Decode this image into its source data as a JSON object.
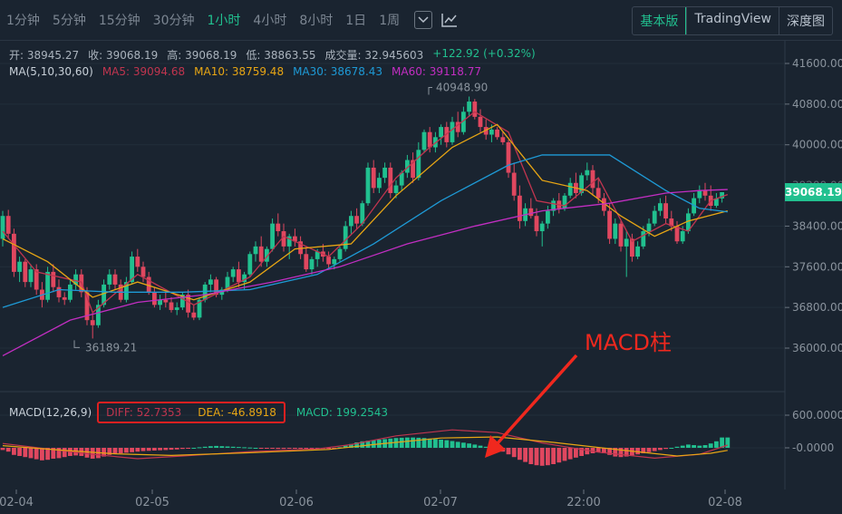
{
  "toolbar": {
    "intervals": [
      "1分钟",
      "5分钟",
      "15分钟",
      "30分钟",
      "1小时",
      "4小时",
      "8小时",
      "1日",
      "1周"
    ],
    "active_interval": "1小时",
    "views": [
      "基本版",
      "TradingView",
      "深度图"
    ],
    "active_view": "基本版"
  },
  "ohlc": {
    "open": "开: 38945.27",
    "close": "收: 39068.19",
    "high": "高: 39068.19",
    "low": "低: 38863.55",
    "volume": "成交量: 32.945603",
    "change": "+122.92 (+0.32%)"
  },
  "ma": {
    "label": "MA(5,10,30,60)",
    "ma5": "MA5: 39094.68",
    "ma10": "MA10: 38759.48",
    "ma30": "MA30: 38678.43",
    "ma60": "MA60: 39118.77"
  },
  "macd": {
    "label": "MACD(12,26,9)",
    "diff": "DIFF: 52.7353",
    "dea": "DEA: -46.8918",
    "macd": "MACD: 199.2543"
  },
  "current_price": "39068.19",
  "annotation": "MACD柱",
  "colors": {
    "up": "#21c08f",
    "down": "#e0475f",
    "ma5": "#c0354f",
    "ma10": "#e8a614",
    "ma30": "#1e9ad6",
    "ma60": "#c22ec2",
    "arrow": "#f0281e"
  },
  "chart_data": {
    "type": "candlestick",
    "price_axis": {
      "ticks": [
        41600,
        40800,
        40000,
        38400,
        37600,
        36800,
        36000
      ],
      "ylim": [
        35700,
        41850
      ]
    },
    "x_ticks": [
      "02-04",
      "02-05",
      "02-06",
      "02-07",
      "22:00",
      "02-08"
    ],
    "high_marker": "40948.90",
    "low_marker": "36189.21",
    "macd_axis": {
      "ticks": [
        "600.0000",
        "-0.0000"
      ]
    },
    "ohlc": [
      [
        38150,
        38700,
        38000,
        38600
      ],
      [
        38600,
        38720,
        38150,
        38250
      ],
      [
        38250,
        38350,
        37400,
        37500
      ],
      [
        37500,
        37800,
        37300,
        37700
      ],
      [
        37700,
        37750,
        37200,
        37300
      ],
      [
        37300,
        37650,
        37200,
        37550
      ],
      [
        37550,
        37650,
        37050,
        37150
      ],
      [
        37150,
        37300,
        36800,
        36950
      ],
      [
        36950,
        37600,
        36900,
        37500
      ],
      [
        37500,
        37650,
        37100,
        37200
      ],
      [
        37200,
        37350,
        36900,
        37000
      ],
      [
        37000,
        37100,
        36850,
        36950
      ],
      [
        36950,
        37350,
        36900,
        37250
      ],
      [
        37250,
        37550,
        37150,
        37450
      ],
      [
        37450,
        37550,
        37000,
        37100
      ],
      [
        37100,
        37200,
        36450,
        36550
      ],
      [
        36550,
        36700,
        36189,
        36450
      ],
      [
        36450,
        36950,
        36400,
        36850
      ],
      [
        36850,
        37350,
        36800,
        37250
      ],
      [
        37250,
        37550,
        37150,
        37450
      ],
      [
        37450,
        37550,
        37150,
        37250
      ],
      [
        37250,
        37350,
        36900,
        36950
      ],
      [
        36950,
        37400,
        36900,
        37300
      ],
      [
        37300,
        37900,
        37250,
        37800
      ],
      [
        37800,
        37950,
        37500,
        37600
      ],
      [
        37600,
        37700,
        37300,
        37400
      ],
      [
        37400,
        37500,
        37050,
        37100
      ],
      [
        37100,
        37200,
        36800,
        36850
      ],
      [
        36850,
        37050,
        36750,
        36950
      ],
      [
        36950,
        37100,
        36800,
        36900
      ],
      [
        36900,
        37000,
        36700,
        36750
      ],
      [
        36750,
        36900,
        36650,
        36800
      ],
      [
        36800,
        37100,
        36750,
        37050
      ],
      [
        37050,
        37150,
        36600,
        36700
      ],
      [
        36700,
        36850,
        36550,
        36600
      ],
      [
        36600,
        37000,
        36550,
        36950
      ],
      [
        36950,
        37300,
        36900,
        37250
      ],
      [
        37250,
        37450,
        37100,
        37350
      ],
      [
        37350,
        37400,
        37000,
        37050
      ],
      [
        37050,
        37200,
        36950,
        37150
      ],
      [
        37150,
        37500,
        37100,
        37400
      ],
      [
        37400,
        37600,
        37300,
        37550
      ],
      [
        37550,
        37700,
        37200,
        37300
      ],
      [
        37300,
        37500,
        37150,
        37450
      ],
      [
        37450,
        37900,
        37400,
        37850
      ],
      [
        37850,
        38100,
        37700,
        38000
      ],
      [
        38000,
        38200,
        37600,
        37700
      ],
      [
        37700,
        38000,
        37600,
        37950
      ],
      [
        37950,
        38550,
        37900,
        38450
      ],
      [
        38450,
        38650,
        38200,
        38300
      ],
      [
        38300,
        38450,
        37900,
        38000
      ],
      [
        38000,
        38250,
        37750,
        38200
      ],
      [
        38200,
        38350,
        38000,
        38100
      ],
      [
        38100,
        38200,
        37750,
        37850
      ],
      [
        37850,
        38000,
        37500,
        37550
      ],
      [
        37550,
        37800,
        37450,
        37750
      ],
      [
        37750,
        37950,
        37600,
        37900
      ],
      [
        37900,
        38050,
        37700,
        37800
      ],
      [
        37800,
        37900,
        37550,
        37650
      ],
      [
        37650,
        37800,
        37550,
        37750
      ],
      [
        37750,
        38000,
        37700,
        37950
      ],
      [
        37950,
        38500,
        37900,
        38400
      ],
      [
        38400,
        38700,
        38250,
        38600
      ],
      [
        38600,
        38750,
        38350,
        38450
      ],
      [
        38450,
        38900,
        38400,
        38850
      ],
      [
        38850,
        39650,
        38800,
        39550
      ],
      [
        39550,
        39700,
        39050,
        39150
      ],
      [
        39150,
        39450,
        39050,
        39350
      ],
      [
        39350,
        39650,
        39250,
        39550
      ],
      [
        39550,
        39650,
        38950,
        39050
      ],
      [
        39050,
        39300,
        38950,
        39200
      ],
      [
        39200,
        39500,
        39100,
        39450
      ],
      [
        39450,
        39800,
        39350,
        39700
      ],
      [
        39700,
        39850,
        39250,
        39350
      ],
      [
        39350,
        40050,
        39300,
        39900
      ],
      [
        39900,
        40300,
        39850,
        40250
      ],
      [
        40250,
        40350,
        39850,
        39950
      ],
      [
        39950,
        40250,
        39850,
        40150
      ],
      [
        40150,
        40400,
        40000,
        40350
      ],
      [
        40350,
        40450,
        39950,
        40050
      ],
      [
        40050,
        40550,
        40000,
        40450
      ],
      [
        40450,
        40650,
        40150,
        40250
      ],
      [
        40250,
        40750,
        40200,
        40650
      ],
      [
        40650,
        40949,
        40550,
        40850
      ],
      [
        40850,
        40900,
        40500,
        40550
      ],
      [
        40550,
        40700,
        40250,
        40350
      ],
      [
        40350,
        40500,
        40100,
        40200
      ],
      [
        40200,
        40400,
        40050,
        40300
      ],
      [
        40300,
        40350,
        40100,
        40150
      ],
      [
        40150,
        40250,
        40000,
        40050
      ],
      [
        40050,
        40100,
        39350,
        39450
      ],
      [
        39450,
        39650,
        38900,
        39000
      ],
      [
        39000,
        39200,
        38350,
        38500
      ],
      [
        38500,
        38850,
        38400,
        38750
      ],
      [
        38750,
        38950,
        38550,
        38600
      ],
      [
        38600,
        38750,
        38200,
        38300
      ],
      [
        38300,
        38500,
        38000,
        38450
      ],
      [
        38450,
        38800,
        38350,
        38700
      ],
      [
        38700,
        38950,
        38600,
        38900
      ],
      [
        38900,
        39050,
        38650,
        38750
      ],
      [
        38750,
        39050,
        38700,
        39000
      ],
      [
        39000,
        39350,
        38950,
        39250
      ],
      [
        39250,
        39450,
        38950,
        39050
      ],
      [
        39050,
        39450,
        39000,
        39400
      ],
      [
        39400,
        39650,
        39300,
        39500
      ],
      [
        39500,
        39600,
        39000,
        39150
      ],
      [
        39150,
        39350,
        38850,
        38950
      ],
      [
        38950,
        39050,
        38600,
        38700
      ],
      [
        38700,
        38850,
        38050,
        38150
      ],
      [
        38150,
        38550,
        38050,
        38450
      ],
      [
        38450,
        38500,
        37900,
        38000
      ],
      [
        38000,
        38300,
        37400,
        38150
      ],
      [
        38150,
        38250,
        37700,
        37800
      ],
      [
        37800,
        38100,
        37750,
        38000
      ],
      [
        38000,
        38400,
        37950,
        38300
      ],
      [
        38300,
        38550,
        38200,
        38450
      ],
      [
        38450,
        38800,
        38400,
        38700
      ],
      [
        38700,
        38950,
        38600,
        38850
      ],
      [
        38850,
        39000,
        38450,
        38550
      ],
      [
        38550,
        38700,
        38300,
        38400
      ],
      [
        38400,
        38500,
        38050,
        38100
      ],
      [
        38100,
        38400,
        38050,
        38300
      ],
      [
        38300,
        38750,
        38250,
        38650
      ],
      [
        38650,
        39050,
        38600,
        38950
      ],
      [
        38950,
        39200,
        38850,
        39100
      ],
      [
        39100,
        39250,
        38900,
        39000
      ],
      [
        39000,
        39200,
        38700,
        38800
      ],
      [
        38800,
        39050,
        38760,
        38945
      ],
      [
        38945,
        39068,
        38863,
        39068
      ]
    ],
    "ma_series": [
      {
        "name": "MA5",
        "points": [
          [
            0,
            38300
          ],
          [
            6,
            37500
          ],
          [
            14,
            37300
          ],
          [
            16,
            36700
          ],
          [
            24,
            37450
          ],
          [
            34,
            36850
          ],
          [
            44,
            37400
          ],
          [
            50,
            38200
          ],
          [
            58,
            37800
          ],
          [
            64,
            38450
          ],
          [
            70,
            39350
          ],
          [
            76,
            39950
          ],
          [
            84,
            40650
          ],
          [
            90,
            40250
          ],
          [
            95,
            38900
          ],
          [
            100,
            38800
          ],
          [
            106,
            39350
          ],
          [
            112,
            38100
          ],
          [
            118,
            38450
          ],
          [
            122,
            38300
          ],
          [
            126,
            38900
          ],
          [
            129,
            39020
          ]
        ]
      },
      {
        "name": "MA10",
        "points": [
          [
            0,
            38150
          ],
          [
            8,
            37700
          ],
          [
            16,
            37000
          ],
          [
            24,
            37300
          ],
          [
            34,
            36950
          ],
          [
            44,
            37300
          ],
          [
            52,
            37950
          ],
          [
            62,
            38050
          ],
          [
            70,
            39000
          ],
          [
            80,
            39950
          ],
          [
            88,
            40400
          ],
          [
            96,
            39300
          ],
          [
            104,
            39100
          ],
          [
            110,
            38600
          ],
          [
            116,
            38200
          ],
          [
            122,
            38500
          ],
          [
            129,
            38700
          ]
        ]
      },
      {
        "name": "MA30",
        "points": [
          [
            0,
            36800
          ],
          [
            10,
            37150
          ],
          [
            20,
            37100
          ],
          [
            32,
            37100
          ],
          [
            44,
            37150
          ],
          [
            56,
            37450
          ],
          [
            66,
            38050
          ],
          [
            78,
            38900
          ],
          [
            90,
            39600
          ],
          [
            96,
            39800
          ],
          [
            108,
            39800
          ],
          [
            118,
            39100
          ],
          [
            124,
            38750
          ],
          [
            129,
            38680
          ]
        ]
      },
      {
        "name": "MA60",
        "points": [
          [
            0,
            35850
          ],
          [
            12,
            36550
          ],
          [
            24,
            36900
          ],
          [
            36,
            37050
          ],
          [
            48,
            37300
          ],
          [
            60,
            37600
          ],
          [
            72,
            38050
          ],
          [
            84,
            38400
          ],
          [
            96,
            38700
          ],
          [
            108,
            38850
          ],
          [
            118,
            39050
          ],
          [
            124,
            39100
          ],
          [
            129,
            39120
          ]
        ]
      }
    ],
    "macd_hist": [
      -40,
      -70,
      -130,
      -150,
      -170,
      -190,
      -210,
      -230,
      -220,
      -200,
      -190,
      -170,
      -150,
      -140,
      -150,
      -180,
      -200,
      -190,
      -160,
      -130,
      -110,
      -100,
      -90,
      -80,
      -70,
      -60,
      -55,
      -50,
      -45,
      -40,
      -35,
      -30,
      -20,
      -10,
      0,
      10,
      20,
      30,
      35,
      30,
      25,
      20,
      15,
      10,
      5,
      0,
      -5,
      -10,
      -15,
      -20,
      -20,
      -15,
      -10,
      -5,
      -5,
      -10,
      -15,
      -20,
      -20,
      -10,
      10,
      40,
      70,
      100,
      120,
      130,
      140,
      150,
      160,
      170,
      180,
      185,
      190,
      190,
      185,
      180,
      170,
      160,
      150,
      140,
      125,
      110,
      95,
      80,
      60,
      40,
      20,
      0,
      -30,
      -70,
      -120,
      -170,
      -220,
      -260,
      -300,
      -320,
      -330,
      -320,
      -300,
      -270,
      -240,
      -210,
      -180,
      -150,
      -120,
      -100,
      -80,
      -100,
      -130,
      -160,
      -170,
      -160,
      -140,
      -120,
      -100,
      -80,
      -60,
      -40,
      -20,
      0,
      20,
      40,
      60,
      50,
      40,
      50,
      80,
      120,
      190,
      190
    ],
    "diff_series": [
      [
        0,
        80
      ],
      [
        8,
        -20
      ],
      [
        16,
        -120
      ],
      [
        24,
        -200
      ],
      [
        32,
        -150
      ],
      [
        44,
        -70
      ],
      [
        56,
        -20
      ],
      [
        62,
        60
      ],
      [
        70,
        220
      ],
      [
        80,
        330
      ],
      [
        88,
        280
      ],
      [
        96,
        90
      ],
      [
        106,
        -80
      ],
      [
        116,
        -190
      ],
      [
        124,
        -120
      ],
      [
        129,
        50
      ]
    ],
    "dea_series": [
      [
        0,
        40
      ],
      [
        10,
        -40
      ],
      [
        20,
        -110
      ],
      [
        30,
        -140
      ],
      [
        44,
        -90
      ],
      [
        58,
        -30
      ],
      [
        66,
        60
      ],
      [
        78,
        180
      ],
      [
        88,
        200
      ],
      [
        98,
        100
      ],
      [
        110,
        -40
      ],
      [
        120,
        -150
      ],
      [
        126,
        -100
      ],
      [
        129,
        -47
      ]
    ],
    "macd_ylim": [
      -350,
      720
    ]
  }
}
